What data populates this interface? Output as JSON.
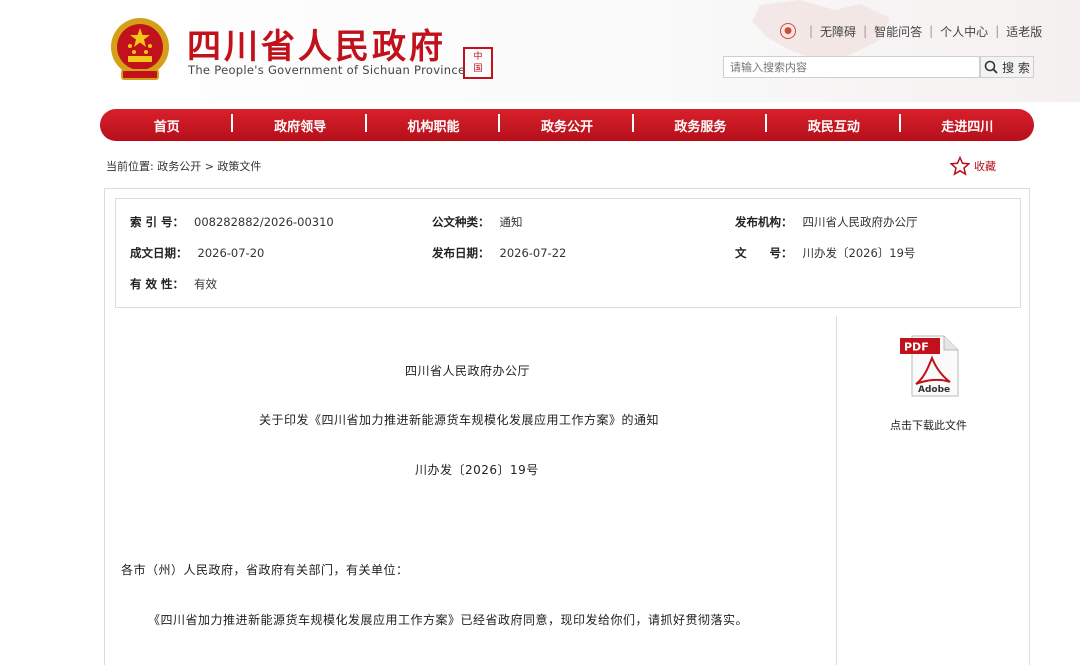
{
  "header": {
    "title": "四川省人民政府",
    "subtitle": "The People's Government of Sichuan Province",
    "seal_text": [
      "中",
      "国",
      "四",
      "川"
    ],
    "links": [
      "无障碍",
      "智能问答",
      "个人中心",
      "适老版"
    ],
    "search_placeholder": "请输入搜索内容",
    "search_button": "搜 索"
  },
  "nav": [
    "首页",
    "政府领导",
    "机构职能",
    "政务公开",
    "政务服务",
    "政民互动",
    "走进四川"
  ],
  "breadcrumb": "当前位置: 政务公开 > 政策文件",
  "favorite": "收藏",
  "meta": {
    "index_label": "索 引 号：",
    "index_value": "008282882/2026-00310",
    "type_label": "公文种类：",
    "type_value": "通知",
    "org_label": "发布机构：",
    "org_value": "四川省人民政府办公厅",
    "created_label": "成文日期：",
    "created_value": "2026-07-20",
    "published_label": "发布日期：",
    "published_value": "2026-07-22",
    "docno_label": "文　　号：",
    "docno_value": "川办发〔2026〕19号",
    "validity_label": "有 效 性：",
    "validity_value": "有效"
  },
  "document": {
    "issuer": "四川省人民政府办公厅",
    "title": "关于印发《四川省加力推进新能源货车规模化发展应用工作方案》的通知",
    "number": "川办发〔2026〕19号",
    "salutation": "各市（州）人民政府，省政府有关部门，有关单位：",
    "body": "《四川省加力推进新能源货车规模化发展应用工作方案》已经省政府同意，现印发给你们，请抓好贯彻落实。"
  },
  "download": {
    "pdf_label": "PDF",
    "adobe_label": "Adobe",
    "label": "点击下载此文件"
  },
  "colors": {
    "brand_red": "#c1121c"
  }
}
